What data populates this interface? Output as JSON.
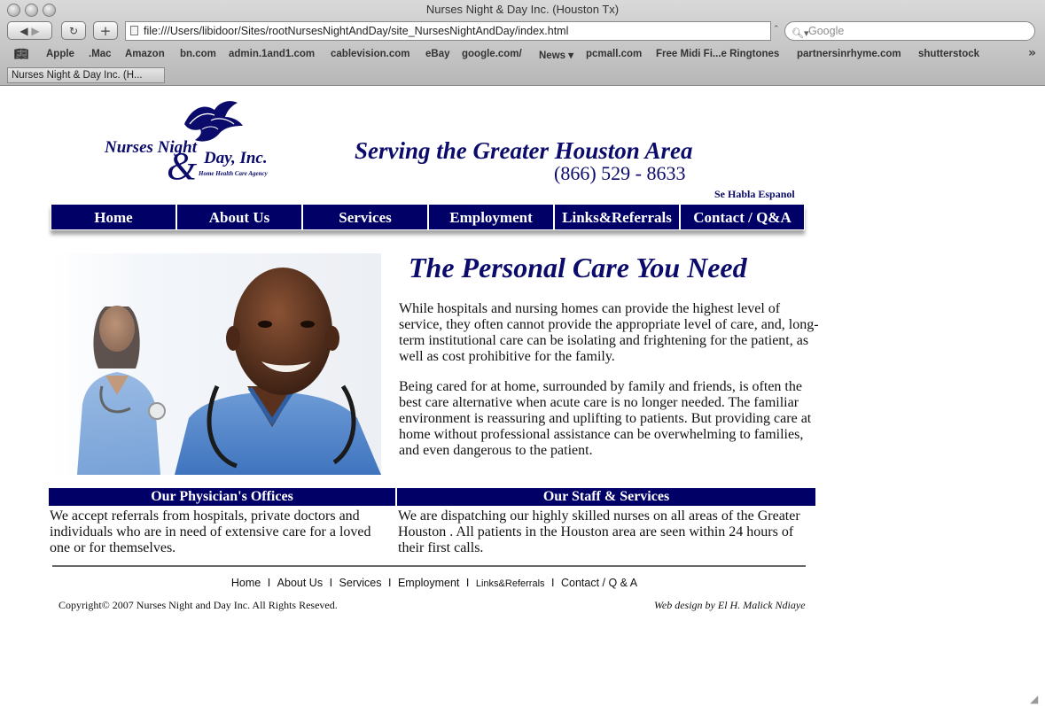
{
  "browser": {
    "window_title": "Nurses Night & Day Inc. (Houston Tx)",
    "url": "file:///Users/libidoor/Sites/rootNursesNightAndDay/site_NursesNightAndDay/index.html",
    "search_placeholder": "Google",
    "bookmarks": [
      "Apple",
      ".Mac",
      "Amazon",
      "bn.com",
      "admin.1and1.com",
      "cablevision.com",
      "eBay",
      "google.com/",
      "News ▾",
      "pcmall.com",
      "Free Midi Fi...e Ringtones",
      "partnersinrhyme.com",
      "shutterstock"
    ],
    "tab_label": "Nurses Night & Day Inc. (H..."
  },
  "logo": {
    "line1": "Nurses Night",
    "amp": "&",
    "line2": "Day, Inc.",
    "sub": "Home Health Care Agency"
  },
  "header": {
    "tagline": "Serving the Greater Houston Area",
    "phone": "(866) 529 - 8633",
    "spanish": "Se Habla Espanol"
  },
  "nav": [
    "Home",
    "About Us",
    "Services",
    "Employment",
    "Links&Referrals",
    "Contact / Q&A"
  ],
  "main": {
    "headline": "The Personal Care You Need",
    "paragraph1": "While hospitals and nursing homes can provide the highest level of service, they often cannot provide the appropriate level of care, and, long-term institutional care can be isolating and frightening for the patient, as well as cost prohibitive for the family.",
    "paragraph2": "Being cared for at home, surrounded by family and friends, is often the best care alternative when acute care is no longer needed. The familiar environment is reassuring and uplifting to patients. But providing care at home without professional assistance can be overwhelming to families, and even dangerous to the patient."
  },
  "boxes": {
    "physicians_title": "Our Physician's Offices",
    "physicians_text": "We accept referrals from hospitals, private doctors and individuals who are in need of extensive care for a loved one or for themselves.",
    "staff_title": "Our Staff & Services",
    "staff_text": "We are dispatching our highly skilled nurses on all areas of the Greater Houston . All patients in the Houston area are seen within 24 hours of their first calls."
  },
  "footer": {
    "links": [
      "Home",
      "About Us",
      "Services",
      "Employment",
      "Links&Referrals",
      "Contact / Q & A"
    ],
    "separator": "I",
    "copyright": "Copyright© 2007 Nurses Night and Day Inc. All Rights Reseved.",
    "credit": "Web design by El H. Malick Ndiaye"
  },
  "colors": {
    "brand_navy": "#000066",
    "text_navy": "#0b0b6b"
  }
}
